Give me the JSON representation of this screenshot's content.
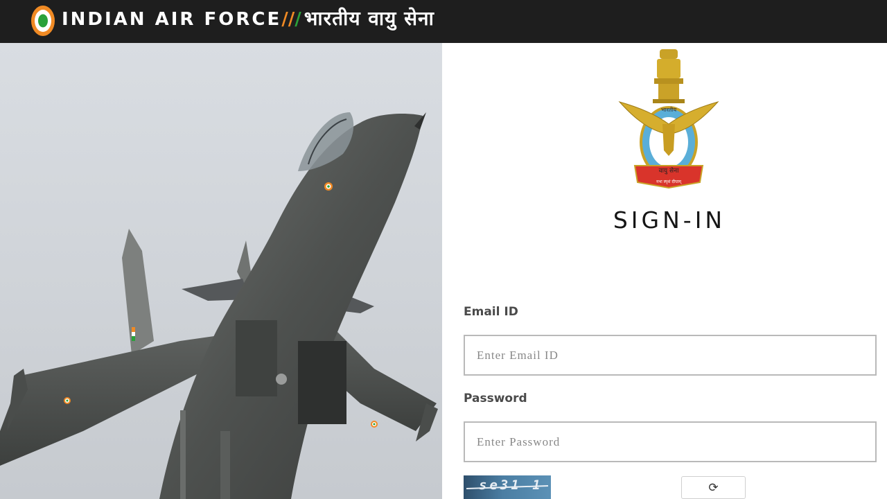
{
  "header": {
    "brand_en": "INDIAN AIR FORCE",
    "sep_orange": "//",
    "sep_green": "/",
    "brand_hi": "भारतीय वायु सेना"
  },
  "colors": {
    "header_bg": "#1e1e1e",
    "saffron": "#f08a24",
    "green": "#2aa13a",
    "field_border": "#b9b9b9"
  },
  "emblem": {
    "text_top": "भारतीय",
    "text_bottom": "वायु सेना",
    "motto": "नभः स्पृशं दीप्तम्"
  },
  "signin": {
    "title": "SIGN-IN",
    "email_label": "Email ID",
    "email_placeholder": "Enter Email ID",
    "password_label": "Password",
    "password_placeholder": "Enter Password",
    "captcha_text": "se31 1",
    "refresh_icon": "refresh-icon",
    "refresh_glyph": "⟳"
  }
}
